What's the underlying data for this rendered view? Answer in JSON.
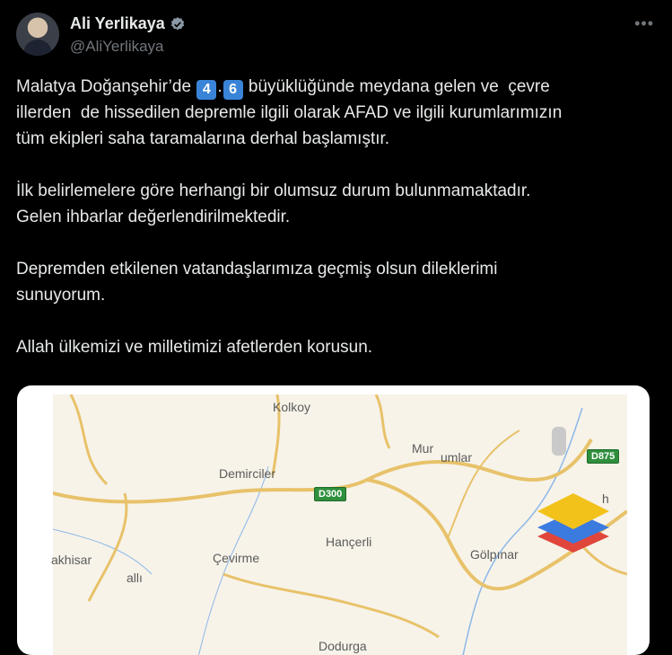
{
  "author": {
    "name": "Ali Yerlikaya",
    "handle": "@AliYerlikaya",
    "more_label": "•••"
  },
  "tweet": {
    "p1_a": "Malatya Doğanşehir’de ",
    "p1_d1": "4",
    "p1_dot": ".",
    "p1_d2": "6",
    "p1_b": " büyüklüğünde meydana gelen ve  çevre\nillerden  de hissedilen depremle ilgili olarak AFAD ve ilgili kurumlarımızın\ntüm ekipleri saha taramalarına derhal başlamıştır.",
    "p2": "\n\nİlk belirlemelere göre herhangi bir olumsuz durum bulunmamaktadır.\nGelen ihbarlar değerlendirilmektedir.",
    "p3": "\n\nDepremden etkilenen vatandaşlarımıza geçmiş olsun dileklerimi\nsunuyorum.",
    "p4": "\n\nAllah ülkemizi ve milletimizi afetlerden korusun."
  },
  "map": {
    "places": {
      "kolkoy": "Kolkoy",
      "mur": "Mur",
      "umlar": "umlar",
      "demirciler": "Demirciler",
      "akhisar": "akhisar",
      "alli": "allı",
      "cevirme": "Çevirme",
      "hancerli": "Hançerli",
      "golpinar": "Gölpınar",
      "h": "h",
      "bottom": "Dodurga"
    },
    "roads": {
      "d300": "D300",
      "d875": "D875"
    },
    "colors": {
      "background": "#f7f3e9",
      "road": "#e8c26a",
      "river": "#8cb7e8",
      "layer_yellow": "#f2c21b",
      "layer_blue": "#3b7be0",
      "layer_red": "#e0463b"
    },
    "layers_icon": "layers-icon"
  }
}
